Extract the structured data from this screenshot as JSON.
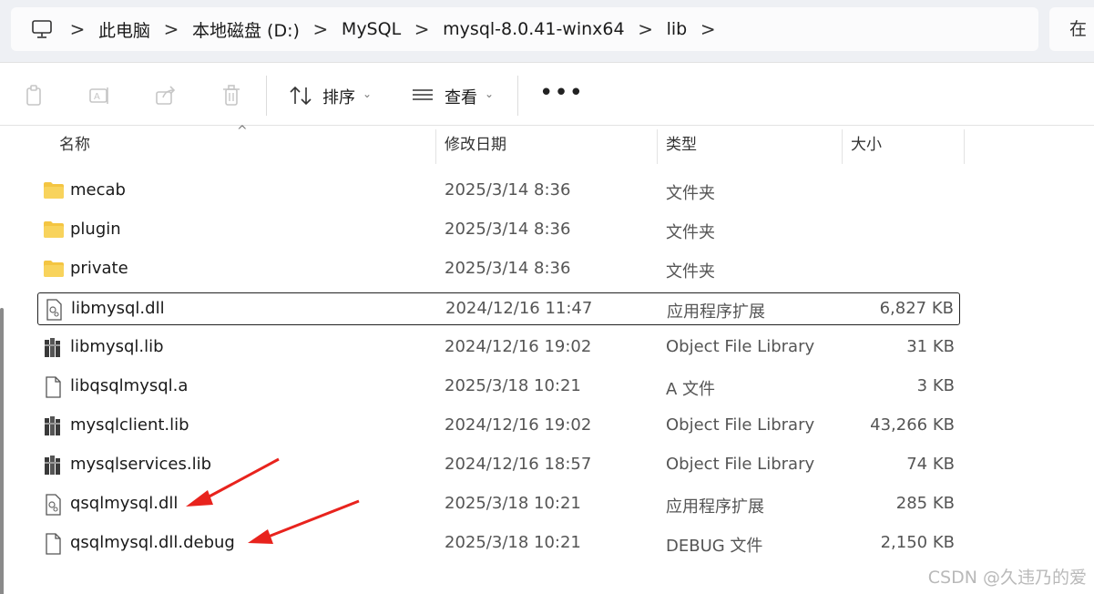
{
  "breadcrumb": {
    "items": [
      "此电脑",
      "本地磁盘 (D:)",
      "MySQL",
      "mysql-8.0.41-winx64",
      "lib"
    ],
    "separator": ">"
  },
  "search": {
    "placeholder": "在"
  },
  "toolbar": {
    "sort_label": "排序",
    "view_label": "查看",
    "more_label": "•••"
  },
  "columns": {
    "name": "名称",
    "date": "修改日期",
    "type": "类型",
    "size": "大小"
  },
  "files": [
    {
      "name": "mecab",
      "date": "2025/3/14 8:36",
      "type": "文件夹",
      "size": "",
      "icon": "folder-icon"
    },
    {
      "name": "plugin",
      "date": "2025/3/14 8:36",
      "type": "文件夹",
      "size": "",
      "icon": "folder-icon"
    },
    {
      "name": "private",
      "date": "2025/3/14 8:36",
      "type": "文件夹",
      "size": "",
      "icon": "folder-icon"
    },
    {
      "name": "libmysql.dll",
      "date": "2024/12/16 11:47",
      "type": "应用程序扩展",
      "size": "6,827 KB",
      "icon": "dll-file-icon",
      "selected": true
    },
    {
      "name": "libmysql.lib",
      "date": "2024/12/16 19:02",
      "type": "Object File Library",
      "size": "31 KB",
      "icon": "library-file-icon"
    },
    {
      "name": "libqsqlmysql.a",
      "date": "2025/3/18 10:21",
      "type": "A 文件",
      "size": "3 KB",
      "icon": "generic-file-icon"
    },
    {
      "name": "mysqlclient.lib",
      "date": "2024/12/16 19:02",
      "type": "Object File Library",
      "size": "43,266 KB",
      "icon": "library-file-icon"
    },
    {
      "name": "mysqlservices.lib",
      "date": "2024/12/16 18:57",
      "type": "Object File Library",
      "size": "74 KB",
      "icon": "library-file-icon"
    },
    {
      "name": "qsqlmysql.dll",
      "date": "2025/3/18 10:21",
      "type": "应用程序扩展",
      "size": "285 KB",
      "icon": "dll-file-icon"
    },
    {
      "name": "qsqlmysql.dll.debug",
      "date": "2025/3/18 10:21",
      "type": "DEBUG 文件",
      "size": "2,150 KB",
      "icon": "generic-file-icon"
    }
  ],
  "watermark": "CSDN @久违乃的爱",
  "colors": {
    "folder": "#f4c542",
    "annotation_arrow": "#e8231d",
    "address_bar_bg": "#eef0f4"
  }
}
